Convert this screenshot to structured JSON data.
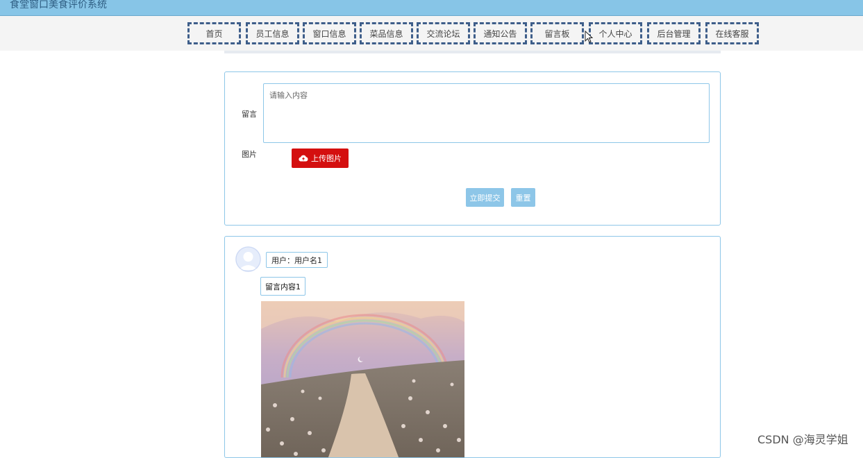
{
  "site": {
    "title": "食堂窗口美食评价系统"
  },
  "nav": [
    {
      "label": "首页"
    },
    {
      "label": "员工信息"
    },
    {
      "label": "窗口信息"
    },
    {
      "label": "菜品信息"
    },
    {
      "label": "交流论坛"
    },
    {
      "label": "通知公告"
    },
    {
      "label": "留言板"
    },
    {
      "label": "个人中心"
    },
    {
      "label": "后台管理"
    },
    {
      "label": "在线客服"
    }
  ],
  "form": {
    "message_label": "留言",
    "message_placeholder": "请输入内容",
    "image_label": "图片",
    "upload_label": "上传图片",
    "submit_label": "立即提交",
    "reset_label": "重置"
  },
  "comment": {
    "user_text": "用户：用户名1",
    "content_text": "留言内容1"
  },
  "watermark": "CSDN @海灵学姐",
  "colors": {
    "header": "#87c5e7",
    "accent": "#8dc6e8",
    "upload": "#d40f0f",
    "nav_border": "#3e5e8a"
  }
}
